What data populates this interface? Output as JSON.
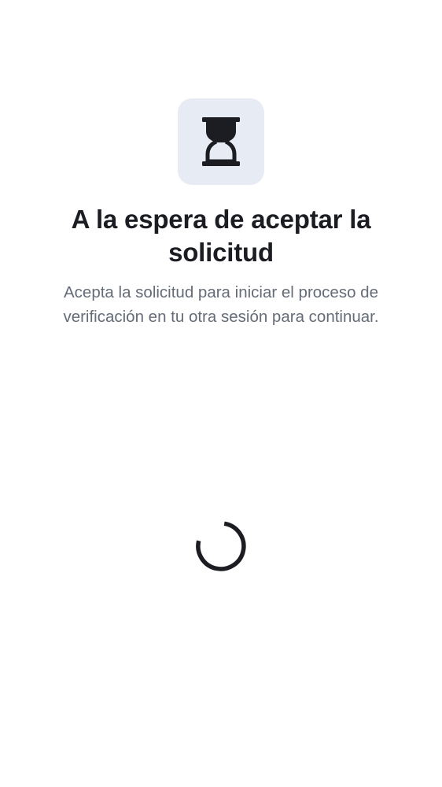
{
  "screen": {
    "icon": "hourglass-icon",
    "title": "A la espera de aceptar la solicitud",
    "description": "Acepta la solicitud para iniciar el proceso de verificación en tu otra sesión para continuar.",
    "loading_indicator": "spinner-icon"
  },
  "colors": {
    "background": "#ffffff",
    "icon_tile_background": "#e7ebf3",
    "icon_color": "#1b1d22",
    "title_color": "#1b1d22",
    "description_color": "#656c77",
    "spinner_color": "#1b1d22"
  }
}
